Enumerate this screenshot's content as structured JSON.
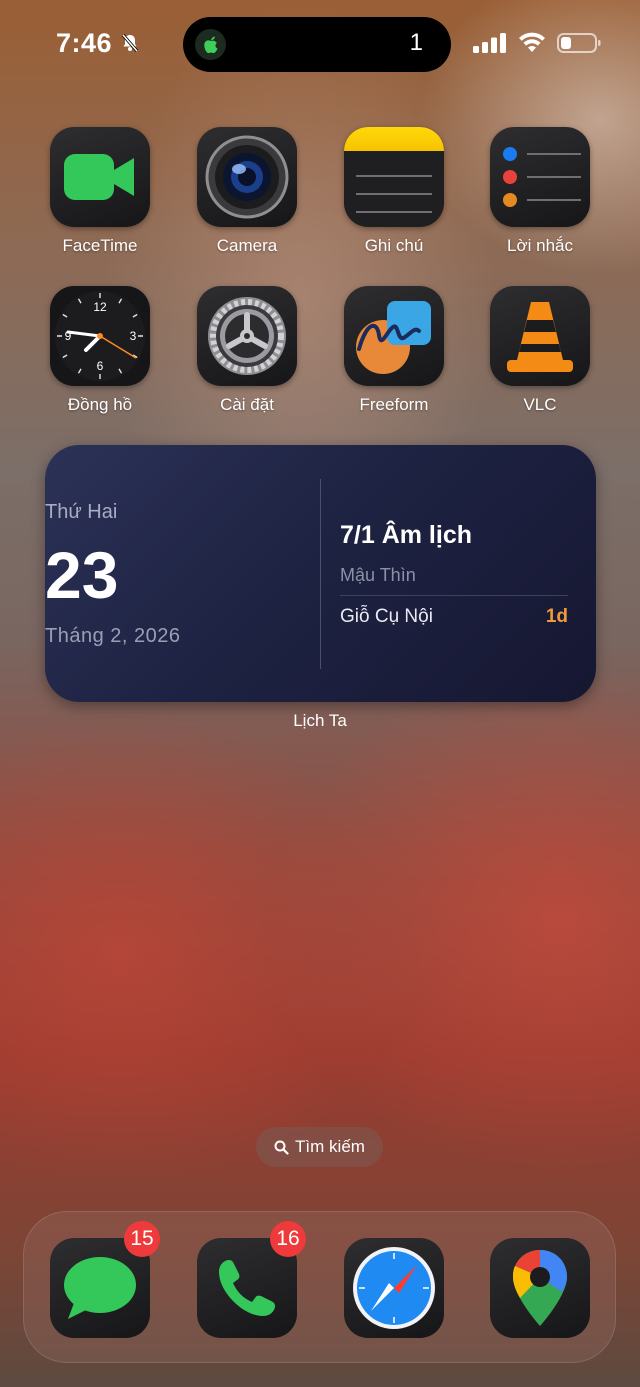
{
  "status_bar": {
    "time": "7:46",
    "island_count": "1",
    "icons": [
      "bell-slash-icon",
      "cellular-signal-icon",
      "wifi-icon",
      "battery-icon"
    ]
  },
  "apps": [
    {
      "label": "FaceTime",
      "icon": "facetime-icon"
    },
    {
      "label": "Camera",
      "icon": "camera-icon"
    },
    {
      "label": "Ghi chú",
      "icon": "notes-icon"
    },
    {
      "label": "Lời nhắc",
      "icon": "reminders-icon"
    },
    {
      "label": "Đồng hồ",
      "icon": "clock-icon"
    },
    {
      "label": "Cài đặt",
      "icon": "settings-gear-icon"
    },
    {
      "label": "Freeform",
      "icon": "freeform-icon"
    },
    {
      "label": "VLC",
      "icon": "vlc-cone-icon"
    }
  ],
  "clock_face": {
    "n12": "12",
    "n3": "3",
    "n6": "6",
    "n9": "9"
  },
  "widget": {
    "day_of_week": "Thứ Hai",
    "day": "23",
    "month_year": "Tháng 2, 2026",
    "lunar_date": "7/1 Âm lịch",
    "lunar_year": "Mậu Thìn",
    "event_name": "Giỗ Cụ Nội",
    "event_days": "1d",
    "label": "Lịch Ta"
  },
  "search": {
    "label": "Tìm kiếm",
    "icon": "search-icon"
  },
  "dock": [
    {
      "icon": "messages-icon",
      "badge": "15"
    },
    {
      "icon": "phone-icon",
      "badge": "16"
    },
    {
      "icon": "safari-compass-icon"
    },
    {
      "icon": "google-maps-icon"
    }
  ],
  "colors": {
    "widget_bg": "#1e2343",
    "event_accent": "#f09a3c",
    "badge": "#ee3a3a",
    "facetime_green": "#34c759",
    "notes_yellow": "#f5c400"
  }
}
